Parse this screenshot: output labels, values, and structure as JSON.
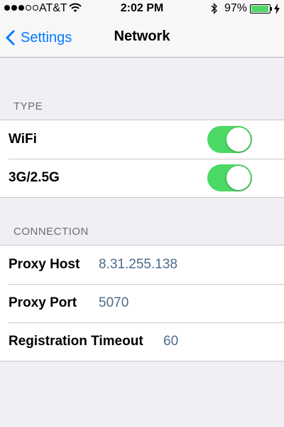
{
  "status_bar": {
    "carrier": "AT&T",
    "time": "2:02 PM",
    "battery_percent": "97%",
    "battery_level": 0.97,
    "signal_bars": 3,
    "signal_total": 5,
    "icons": [
      "wifi-icon",
      "bluetooth-icon",
      "battery-icon",
      "charging-icon"
    ]
  },
  "nav": {
    "back_label": "Settings",
    "title": "Network"
  },
  "sections": {
    "type": {
      "header": "TYPE",
      "rows": [
        {
          "label": "WiFi",
          "on": true
        },
        {
          "label": "3G/2.5G",
          "on": true
        }
      ]
    },
    "connection": {
      "header": "CONNECTION",
      "rows": [
        {
          "label": "Proxy Host",
          "value": "8.31.255.138"
        },
        {
          "label": "Proxy Port",
          "value": "5070"
        },
        {
          "label": "Registration Timeout",
          "value": "60"
        }
      ]
    }
  },
  "colors": {
    "accent": "#007aff",
    "toggle_on": "#4cd964",
    "value_text": "#4f6a8c",
    "background": "#efeff4"
  }
}
